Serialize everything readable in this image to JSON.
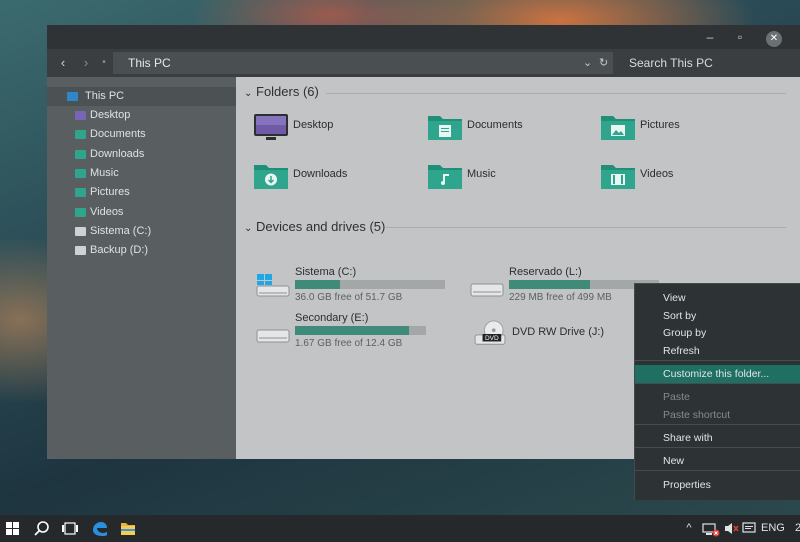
{
  "window": {
    "controls": {
      "minimize": "–",
      "maximize": "▫",
      "close": "✕"
    }
  },
  "address": {
    "back": "‹",
    "forward": "›",
    "up": "•",
    "path": "This PC",
    "dropdown": "⌄",
    "refresh": "↻",
    "search_placeholder": "Search This PC"
  },
  "sidebar": {
    "items": [
      {
        "label": "This PC",
        "icon": "computer-icon",
        "color": "#2f86c9"
      },
      {
        "label": "Desktop",
        "icon": "desktop-icon",
        "color": "#7a64b5"
      },
      {
        "label": "Documents",
        "icon": "documents-folder-icon",
        "color": "#2ea58c"
      },
      {
        "label": "Downloads",
        "icon": "downloads-folder-icon",
        "color": "#2ea58c"
      },
      {
        "label": "Music",
        "icon": "music-folder-icon",
        "color": "#2ea58c"
      },
      {
        "label": "Pictures",
        "icon": "pictures-folder-icon",
        "color": "#2ea58c"
      },
      {
        "label": "Videos",
        "icon": "videos-folder-icon",
        "color": "#2ea58c"
      },
      {
        "label": "Sistema (C:)",
        "icon": "drive-icon",
        "color": "#cfd2d3"
      },
      {
        "label": "Backup (D:)",
        "icon": "drive-icon",
        "color": "#cfd2d3"
      }
    ]
  },
  "folders": {
    "header": "Folders (6)",
    "items": [
      {
        "label": "Desktop",
        "icon": "desktop-icon"
      },
      {
        "label": "Documents",
        "icon": "documents-folder-icon"
      },
      {
        "label": "Pictures",
        "icon": "pictures-folder-icon"
      },
      {
        "label": "Downloads",
        "icon": "downloads-folder-icon"
      },
      {
        "label": "Music",
        "icon": "music-folder-icon"
      },
      {
        "label": "Videos",
        "icon": "videos-folder-icon"
      }
    ]
  },
  "drives": {
    "header": "Devices and drives (5)",
    "items": [
      {
        "name": "Sistema (C:)",
        "free": "36.0 GB free of 51.7 GB",
        "used_fraction": 0.3
      },
      {
        "name": "Reservado (L:)",
        "free": "229 MB free of 499 MB",
        "used_fraction": 0.54
      },
      {
        "name": "Secondary (E:)",
        "free": "1.67 GB free of 12.4 GB",
        "used_fraction": 0.87
      },
      {
        "name": "DVD RW Drive (J:)",
        "dvd_label": "DVD"
      }
    ]
  },
  "context_menu": {
    "items": [
      {
        "label": "View",
        "disabled": false
      },
      {
        "label": "Sort by",
        "disabled": false
      },
      {
        "label": "Group by",
        "disabled": false
      },
      {
        "label": "Refresh",
        "disabled": false
      },
      {
        "label": "Customize this folder...",
        "disabled": false,
        "highlighted": true
      },
      {
        "label": "Paste",
        "disabled": true
      },
      {
        "label": "Paste shortcut",
        "disabled": true
      },
      {
        "label": "Share with",
        "disabled": false
      },
      {
        "label": "New",
        "disabled": false
      },
      {
        "label": "Properties",
        "disabled": false
      }
    ]
  },
  "taskbar": {
    "language": "ENG",
    "clock_partial": "2",
    "tray_up": "^"
  },
  "colors": {
    "accent": "#2ea58c",
    "menu_highlight": "#1f6f62",
    "drive_bar": "#3f8a78"
  }
}
